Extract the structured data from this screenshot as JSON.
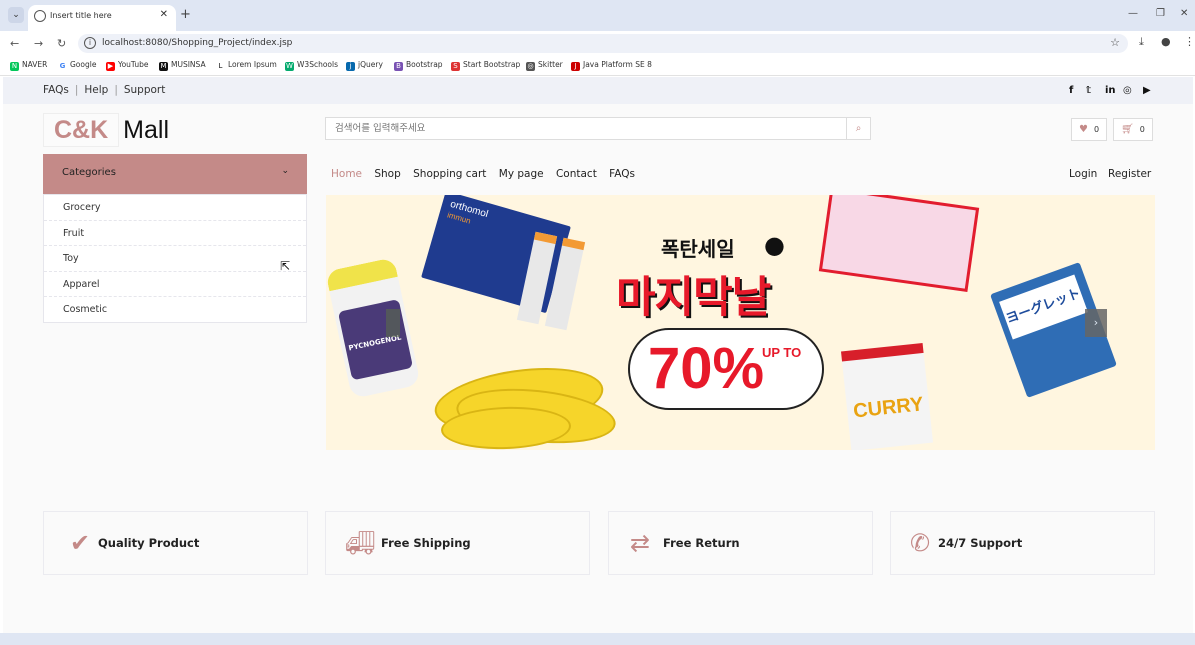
{
  "browser": {
    "tab_title": "Insert title here",
    "url": "localhost:8080/Shopping_Project/index.jsp",
    "bookmarks": [
      {
        "label": "NAVER",
        "color": "#03c75a",
        "glyph": "N"
      },
      {
        "label": "Google",
        "color": "#ffffff",
        "glyph": "G"
      },
      {
        "label": "YouTube",
        "color": "#ff0000",
        "glyph": "▶"
      },
      {
        "label": "MUSINSA",
        "color": "#111111",
        "glyph": "M"
      },
      {
        "label": "Lorem Ipsum",
        "color": "#ffffff",
        "glyph": "L"
      },
      {
        "label": "W3Schools",
        "color": "#04aa6d",
        "glyph": "W"
      },
      {
        "label": "jQuery",
        "color": "#0769ad",
        "glyph": "j"
      },
      {
        "label": "Bootstrap",
        "color": "#7952b3",
        "glyph": "B"
      },
      {
        "label": "Start Bootstrap",
        "color": "#dd3333",
        "glyph": "S"
      },
      {
        "label": "Skitter",
        "color": "#555555",
        "glyph": "◎"
      },
      {
        "label": "Java Platform SE 8",
        "color": "#cc0000",
        "glyph": "J"
      }
    ]
  },
  "topbar": {
    "links": [
      "FAQs",
      "Help",
      "Support"
    ],
    "social_icons": [
      "facebook-icon",
      "twitter-icon",
      "linkedin-icon",
      "instagram-icon",
      "youtube-icon"
    ]
  },
  "header": {
    "logo_accent": "C&K",
    "logo_text": "Mall",
    "search_placeholder": "검색어를 입력해주세요",
    "wishlist_count": "0",
    "cart_count": "0"
  },
  "categories": {
    "title": "Categories",
    "items": [
      "Grocery",
      "Fruit",
      "Toy",
      "Apparel",
      "Cosmetic"
    ]
  },
  "nav": {
    "items": [
      "Home",
      "Shop",
      "Shopping cart",
      "My page",
      "Contact",
      "FAQs"
    ],
    "active": "Home",
    "login": "Login",
    "register": "Register"
  },
  "banner": {
    "tagline": "폭탄세일",
    "headline": "마지막날",
    "discount": "70%",
    "upto": "UP TO",
    "box_brand": "orthomol",
    "box_sub": "immun",
    "bottle_label": "PYCNOGENOL",
    "cup_label": "CURRY",
    "yogurt_label": "ヨーグレット"
  },
  "features": [
    {
      "label": "Quality Product",
      "icon": "check-icon"
    },
    {
      "label": "Free Shipping",
      "icon": "truck-icon"
    },
    {
      "label": "Free Return",
      "icon": "exchange-icon"
    },
    {
      "label": "24/7 Support",
      "icon": "phone-icon"
    }
  ],
  "colors": {
    "accent": "#c48a88",
    "topbar_bg": "#eff1f7",
    "banner_red": "#e7192a"
  }
}
